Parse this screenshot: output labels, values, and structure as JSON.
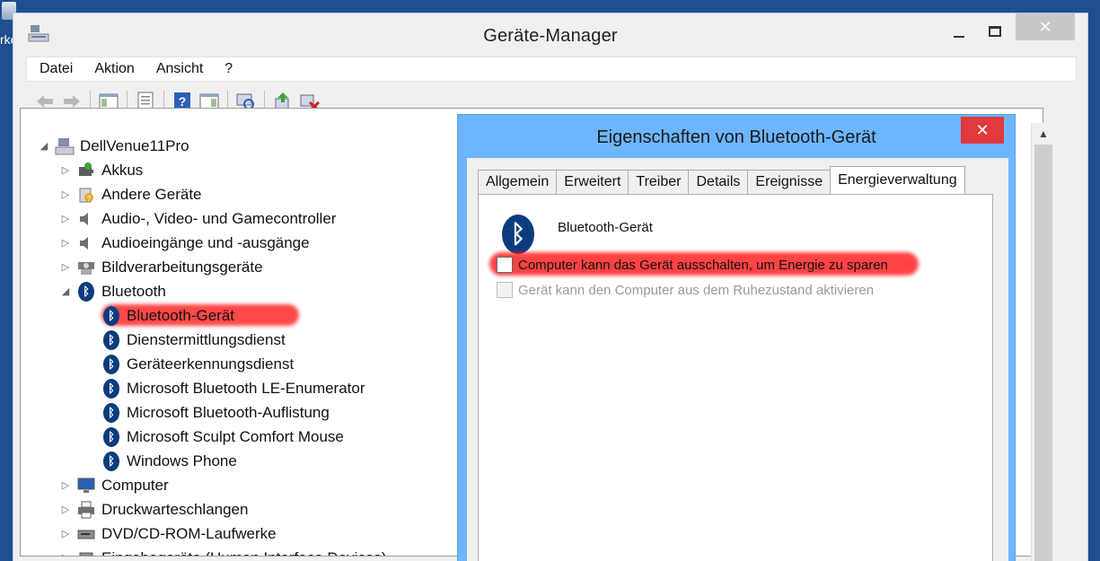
{
  "desktop": {
    "icon_label": "rke"
  },
  "main_window": {
    "title": "Geräte-Manager",
    "controls": {
      "minimize": "—",
      "maximize": "☐",
      "close": "✕"
    },
    "menu": [
      "Datei",
      "Aktion",
      "Ansicht",
      "?"
    ],
    "toolbar_icons": [
      "back-arrow-icon",
      "forward-arrow-icon",
      "show-hide-console-tree-icon",
      "properties-icon",
      "help-icon",
      "action-pane-icon",
      "scan-hardware-icon",
      "update-driver-icon",
      "uninstall-device-icon"
    ]
  },
  "tree": {
    "root": "DellVenue11Pro",
    "nodes": [
      {
        "label": "Akkus",
        "expander": "▷"
      },
      {
        "label": "Andere Geräte",
        "expander": "▷"
      },
      {
        "label": "Audio-, Video- und Gamecontroller",
        "expander": "▷"
      },
      {
        "label": "Audioeingänge und -ausgänge",
        "expander": "▷"
      },
      {
        "label": "Bildverarbeitungsgeräte",
        "expander": "▷"
      },
      {
        "label": "Bluetooth",
        "expander": "◢"
      },
      {
        "label": "Computer",
        "expander": "▷"
      },
      {
        "label": "Druckwarteschlangen",
        "expander": "▷"
      },
      {
        "label": "DVD/CD-ROM-Laufwerke",
        "expander": "▷"
      },
      {
        "label": "Eingabegeräte (Human Interface Devices)",
        "expander": "▷"
      }
    ],
    "bluetooth_children": [
      "Bluetooth-Gerät",
      "Dienstermittlungsdienst",
      "Geräteerkennungsdienst",
      "Microsoft Bluetooth LE-Enumerator",
      "Microsoft Bluetooth-Auflistung",
      "Microsoft Sculpt Comfort Mouse",
      "Windows Phone"
    ]
  },
  "dialog": {
    "title": "Eigenschaften von Bluetooth-Gerät",
    "close": "✕",
    "tabs": [
      "Allgemein",
      "Erweitert",
      "Treiber",
      "Details",
      "Ereignisse",
      "Energieverwaltung"
    ],
    "active_tab": "Energieverwaltung",
    "device_name": "Bluetooth-Gerät",
    "options": [
      {
        "label": "Computer kann das Gerät ausschalten, um Energie zu sparen",
        "checked": false,
        "enabled": true
      },
      {
        "label": "Gerät kann den Computer aus dem Ruhezustand aktivieren",
        "checked": false,
        "enabled": false
      }
    ]
  },
  "colors": {
    "desktop": "#1e4f8f",
    "dialog_frame": "#6db6ff",
    "highlight": "#ff1414",
    "bluetooth": "#0b3c7d"
  }
}
